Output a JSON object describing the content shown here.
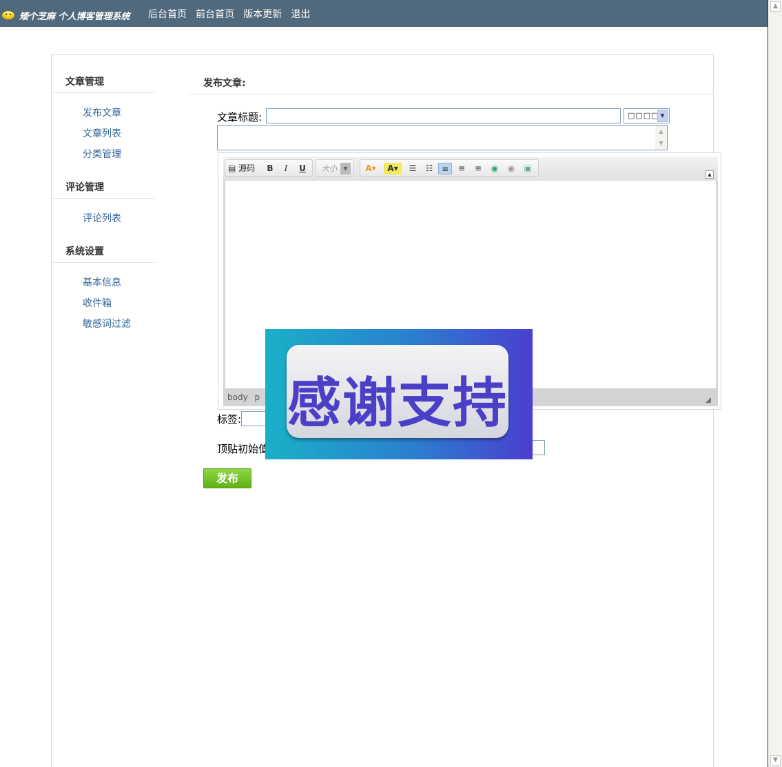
{
  "header": {
    "brand": "矮个芝麻 个人博客管理系统",
    "nav": [
      "后台首页",
      "前台首页",
      "版本更新",
      "退出"
    ]
  },
  "sidebar": {
    "sections": [
      {
        "title": "文章管理",
        "items": [
          "发布文章",
          "文章列表",
          "分类管理"
        ]
      },
      {
        "title": "评论管理",
        "items": [
          "评论列表"
        ]
      },
      {
        "title": "系统设置",
        "items": [
          "基本信息",
          "收件箱",
          "敏感词过滤"
        ]
      }
    ]
  },
  "main": {
    "heading": "发布文章:",
    "title_label": "文章标题:",
    "category_value": "□□□□",
    "tags_label": "标签:",
    "top_label": "顶贴初始值",
    "publish_label": "发布"
  },
  "editor": {
    "source_label": "源码",
    "bold": "B",
    "italic": "I",
    "underline": "U",
    "fontsize_label": "大小",
    "path": [
      "body",
      "p"
    ]
  },
  "banner": {
    "text": "感谢支持"
  },
  "colors": {
    "topbar": "#51697c",
    "link": "#336699",
    "publish": "#6cbf22",
    "banner_text": "#4a3fc6"
  }
}
